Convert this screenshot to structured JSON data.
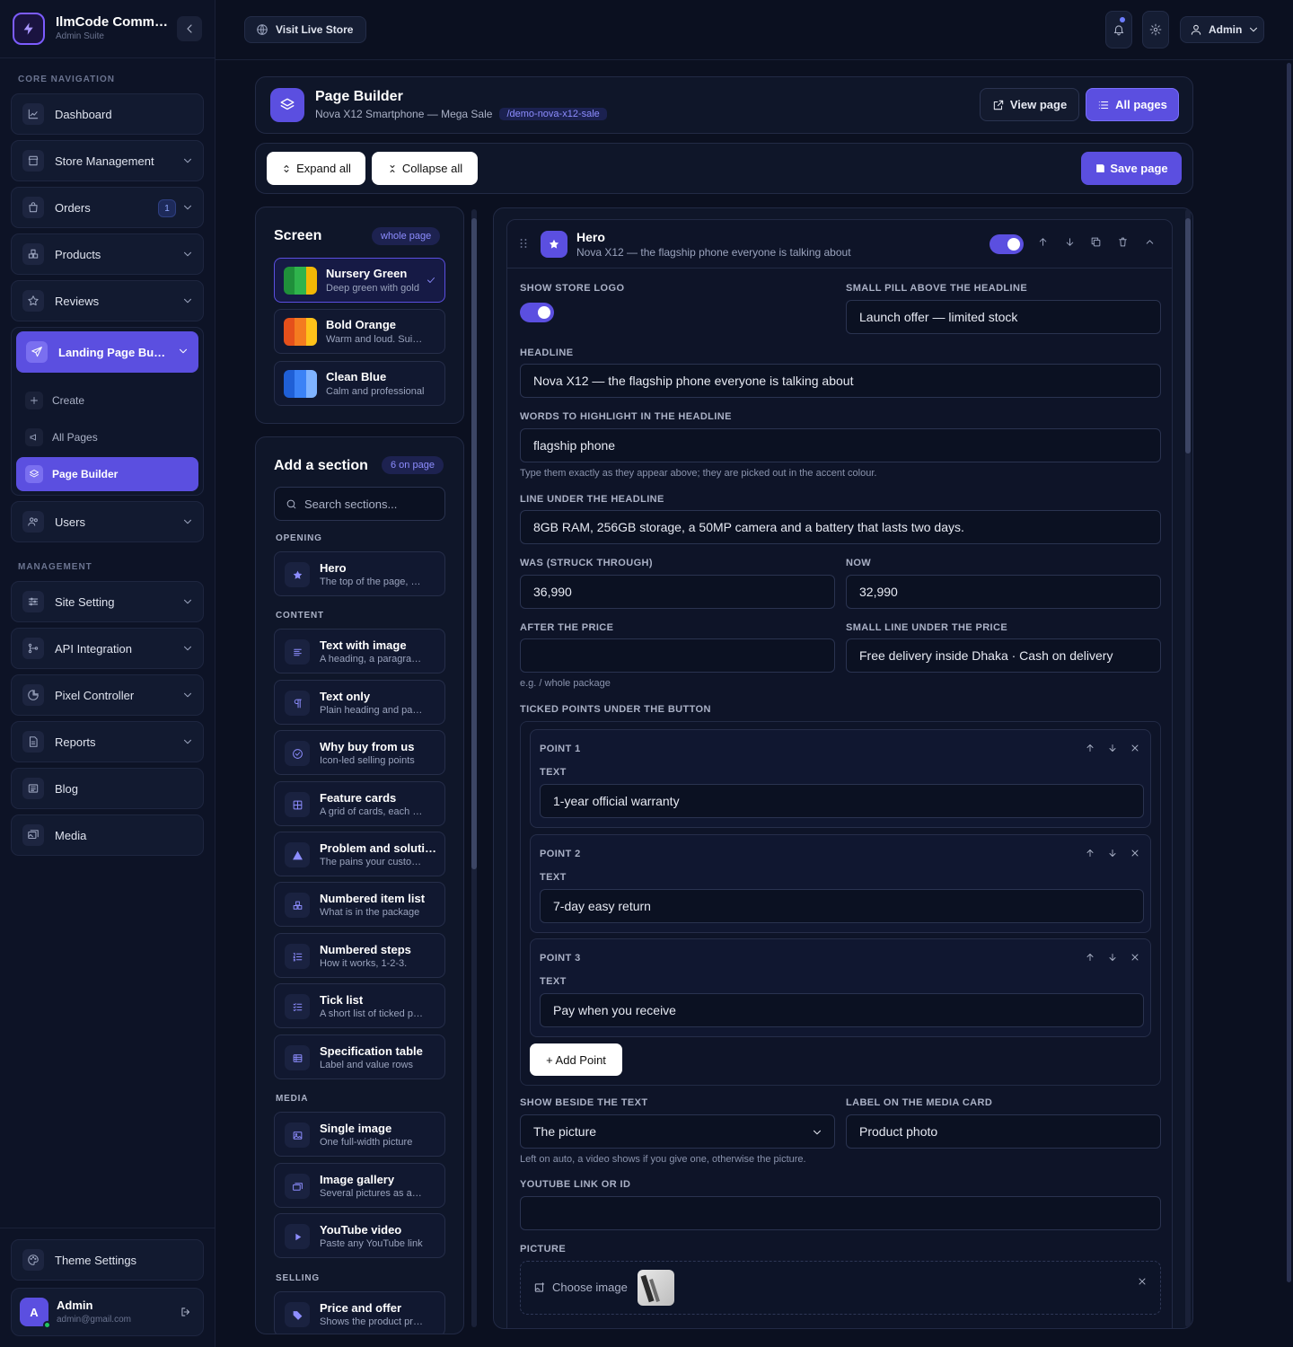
{
  "brand": {
    "name": "IlmCode Commerce",
    "sub": "Admin Suite"
  },
  "sidebar": {
    "core_label": "CORE NAVIGATION",
    "management_label": "MANAGEMENT",
    "core_items": [
      {
        "label": "Dashboard",
        "icon": "chart-icon"
      },
      {
        "label": "Store Management",
        "icon": "store-icon"
      },
      {
        "label": "Orders",
        "icon": "bag-icon",
        "count": "1"
      },
      {
        "label": "Products",
        "icon": "boxes-icon"
      },
      {
        "label": "Reviews",
        "icon": "star-icon"
      }
    ],
    "landing": {
      "label": "Landing Page Builder",
      "subs": [
        {
          "label": "Create"
        },
        {
          "label": "All Pages"
        },
        {
          "label": "Page Builder"
        }
      ]
    },
    "users_label": "Users",
    "management_items": [
      {
        "label": "Site Setting"
      },
      {
        "label": "API Integration"
      },
      {
        "label": "Pixel Controller"
      },
      {
        "label": "Reports"
      },
      {
        "label": "Blog"
      },
      {
        "label": "Media"
      }
    ],
    "theme_settings": "Theme Settings",
    "profile": {
      "initial": "A",
      "name": "Admin",
      "email": "admin@gmail.com"
    }
  },
  "topbar": {
    "visit": "Visit Live Store",
    "admin": "Admin"
  },
  "header": {
    "title": "Page Builder",
    "subtitle": "Nova X12 Smartphone — Mega Sale",
    "slug": "/demo-nova-x12-sale",
    "view_page": "View page",
    "all_pages": "All pages"
  },
  "toolbar": {
    "expand": "Expand all",
    "collapse": "Collapse all",
    "save": "Save page"
  },
  "screen": {
    "title": "Screen",
    "pill": "whole page",
    "themes": [
      {
        "name": "Nursery Green",
        "desc": "Deep green with gold",
        "colors": [
          "#1f8f3a",
          "#2fb34c",
          "#f2b705"
        ]
      },
      {
        "name": "Bold Orange",
        "desc": "Warm and loud. Suits sales",
        "colors": [
          "#e5501b",
          "#f47b20",
          "#ffc21a"
        ]
      },
      {
        "name": "Clean Blue",
        "desc": "Calm and professional",
        "colors": [
          "#1f5fd6",
          "#3b82f6",
          "#7fb3ff"
        ]
      }
    ]
  },
  "add_section": {
    "title": "Add a section",
    "pill": "6 on page",
    "search_placeholder": "Search sections...",
    "categories": {
      "opening": "OPENING",
      "content": "CONTENT",
      "media": "MEDIA",
      "selling": "SELLING"
    },
    "opening": [
      {
        "name": "Hero",
        "desc": "The top of the page, with headline"
      }
    ],
    "content": [
      {
        "name": "Text with image",
        "desc": "A heading, a paragraph and a picture"
      },
      {
        "name": "Text only",
        "desc": "Plain heading and paragraph"
      },
      {
        "name": "Why buy from us",
        "desc": "Icon-led selling points"
      },
      {
        "name": "Feature cards",
        "desc": "A grid of cards, each with an icon"
      },
      {
        "name": "Problem and solution",
        "desc": "The pains your customer has"
      },
      {
        "name": "Numbered item list",
        "desc": "What is in the package"
      },
      {
        "name": "Numbered steps",
        "desc": "How it works, 1-2-3."
      },
      {
        "name": "Tick list",
        "desc": "A short list of ticked points"
      },
      {
        "name": "Specification table",
        "desc": "Label and value rows"
      }
    ],
    "media": [
      {
        "name": "Single image",
        "desc": "One full-width picture"
      },
      {
        "name": "Image gallery",
        "desc": "Several pictures as a grid"
      },
      {
        "name": "YouTube video",
        "desc": "Paste any YouTube link"
      }
    ],
    "selling": [
      {
        "name": "Price and offer",
        "desc": "Shows the product price"
      }
    ]
  },
  "hero": {
    "name": "Hero",
    "desc": "Nova X12 — the flagship phone everyone is talking about",
    "enabled": true,
    "labels": {
      "show_logo": "Show store logo",
      "pill": "Small pill above the headline",
      "headline": "Headline",
      "highlight": "Words to highlight in the headline",
      "line_under": "Line under the headline",
      "was": "Was (struck through)",
      "now": "Now",
      "after_price": "After the price",
      "small_line": "Small line under the price",
      "ticked": "Ticked points under the button",
      "show_beside": "Show beside the text",
      "media_label": "Label on the media card",
      "youtube": "YouTube link or ID",
      "picture": "Picture"
    },
    "values": {
      "pill": "Launch offer — limited stock",
      "headline": "Nova X12 — the flagship phone everyone is talking about",
      "highlight": "flagship phone",
      "line_under": "8GB RAM, 256GB storage, a 50MP camera and a battery that lasts two days.",
      "was": "36,990",
      "now": "32,990",
      "after_price": "",
      "small_line": "Free delivery inside Dhaka · Cash on delivery",
      "show_beside": "The picture",
      "media_label": "Product photo",
      "youtube": ""
    },
    "hints": {
      "highlight": "Type them exactly as they appear above; they are picked out in the accent colour.",
      "after_price": "e.g. / whole package",
      "show_beside": "Left on auto, a video shows if you give one, otherwise the picture."
    },
    "points": [
      {
        "title": "POINT 1",
        "label": "TEXT",
        "value": "1-year official warranty"
      },
      {
        "title": "POINT 2",
        "label": "TEXT",
        "value": "7-day easy return"
      },
      {
        "title": "POINT 3",
        "label": "TEXT",
        "value": "Pay when you receive"
      }
    ],
    "add_point": "+ Add Point",
    "choose_image": "Choose image"
  },
  "colors": {
    "accent": "#5b4fe0",
    "bg": "#0b1020",
    "panel": "#0f1629"
  }
}
